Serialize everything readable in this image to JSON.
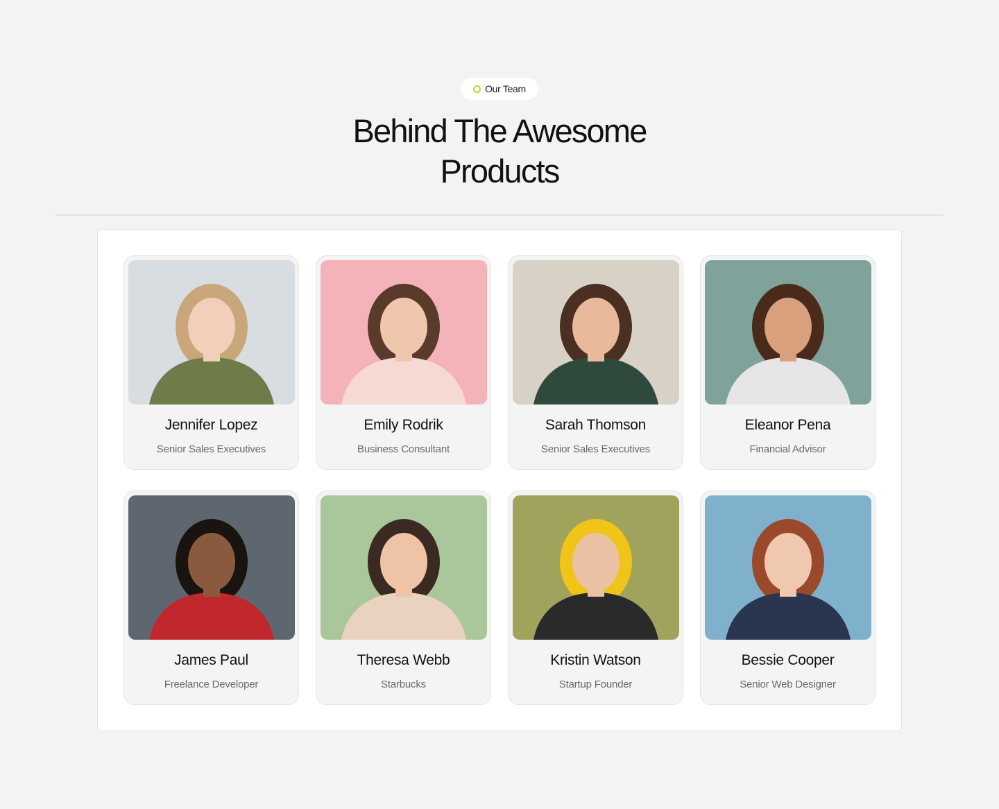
{
  "header": {
    "badge": {
      "label": "Our Team",
      "icon": "ring-dot-icon",
      "accent": "#b3d335"
    },
    "title_line1": "Behind The Awesome",
    "title_line2": "Products"
  },
  "team": [
    {
      "name": "Jennifer Lopez",
      "role": "Senior Sales Executives",
      "bg": "#d7dde0",
      "hair": "#c9a77a",
      "skin": "#f2cfb8",
      "shirt": "#6d7c48"
    },
    {
      "name": "Emily Rodrik",
      "role": "Business Consultant",
      "bg": "#f4b3b8",
      "hair": "#5a3a2a",
      "skin": "#f0c6ad",
      "shirt": "#f5d9d2"
    },
    {
      "name": "Sarah Thomson",
      "role": "Senior Sales Executives",
      "bg": "#d8d2c6",
      "hair": "#4a2f22",
      "skin": "#e9b99c",
      "shirt": "#2f4a3c"
    },
    {
      "name": "Eleanor Pena",
      "role": "Financial Advisor",
      "bg": "#7fa29a",
      "hair": "#4a2a1a",
      "skin": "#d9a07e",
      "shirt": "#e6e6e6"
    },
    {
      "name": "James Paul",
      "role": "Freelance Developer",
      "bg": "#5e6670",
      "hair": "#1a1410",
      "skin": "#8a5a3e",
      "shirt": "#c0282d"
    },
    {
      "name": "Theresa Webb",
      "role": "Starbucks",
      "bg": "#a9c79a",
      "hair": "#3a2a22",
      "skin": "#efc3a6",
      "shirt": "#e9d2c0"
    },
    {
      "name": "Kristin Watson",
      "role": "Startup Founder",
      "bg": "#9fa35c",
      "hair": "#f0c419",
      "skin": "#ebc1a4",
      "shirt": "#2a2a2a"
    },
    {
      "name": "Bessie Cooper",
      "role": "Senior Web Designer",
      "bg": "#7fb1cc",
      "hair": "#9a4a2a",
      "skin": "#f0c8b0",
      "shirt": "#2a3550"
    }
  ]
}
